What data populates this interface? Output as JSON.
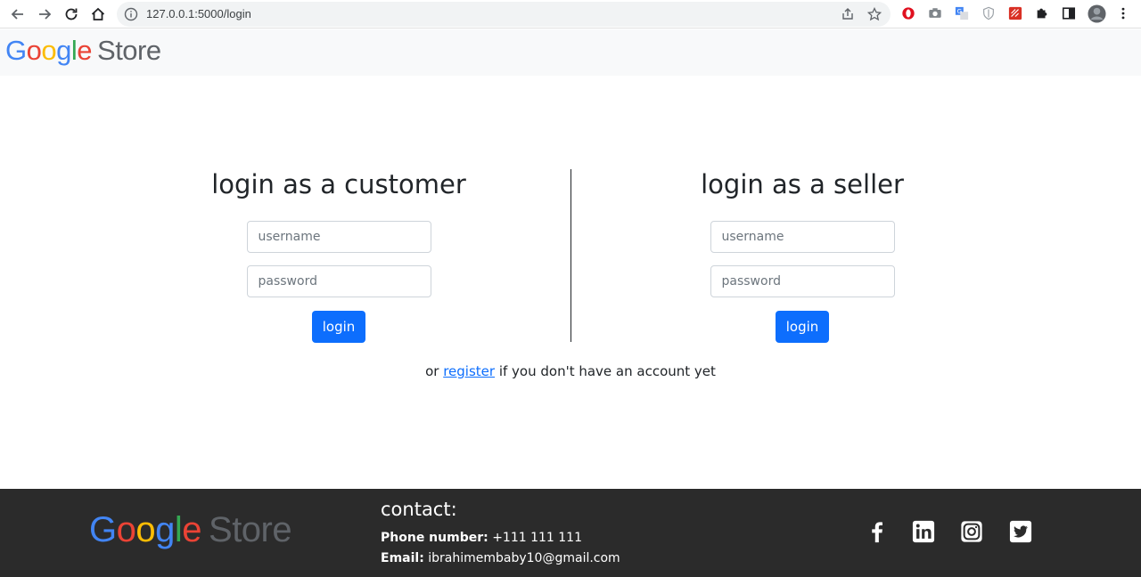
{
  "browser": {
    "url": "127.0.0.1:5000/login",
    "nav_icons": [
      "back-icon",
      "forward-icon",
      "reload-icon",
      "home-icon"
    ],
    "omnibox_icons": [
      "site-info-icon",
      "share-icon",
      "bookmark-star-icon"
    ],
    "extension_icons": [
      "opera-icon",
      "camera-icon",
      "translate-icon",
      "shield-icon",
      "ruler-extension-icon",
      "puzzle-icon",
      "side-panel-icon",
      "profile-avatar-icon",
      "menu-dots-icon"
    ]
  },
  "header": {
    "brand_letters": [
      "G",
      "o",
      "o",
      "g",
      "l",
      "e"
    ],
    "brand_store": "Store"
  },
  "customer": {
    "heading": "login as a customer",
    "username_placeholder": "username",
    "password_placeholder": "password",
    "login_label": "login"
  },
  "seller": {
    "heading": "login as a seller",
    "username_placeholder": "username",
    "password_placeholder": "password",
    "login_label": "login"
  },
  "register": {
    "prefix": "or ",
    "link": "register",
    "suffix": " if you don't have an account yet"
  },
  "footer": {
    "brand_store": "Store",
    "contact_title": "contact:",
    "phone_label": "Phone number:",
    "phone_value": "+111 111 111",
    "email_label": "Email:",
    "email_value": "ibrahimembaby10@gmail.com",
    "social_icons": [
      "facebook-icon",
      "linkedin-icon",
      "instagram-icon",
      "twitter-icon"
    ]
  },
  "colors": {
    "primary": "#0d6efd",
    "footer_bg": "#2b2b2b",
    "header_bg": "#f8f9fa",
    "google_blue": "#4285F4",
    "google_red": "#EA4335",
    "google_yellow": "#FBBC05",
    "google_green": "#34A853"
  }
}
